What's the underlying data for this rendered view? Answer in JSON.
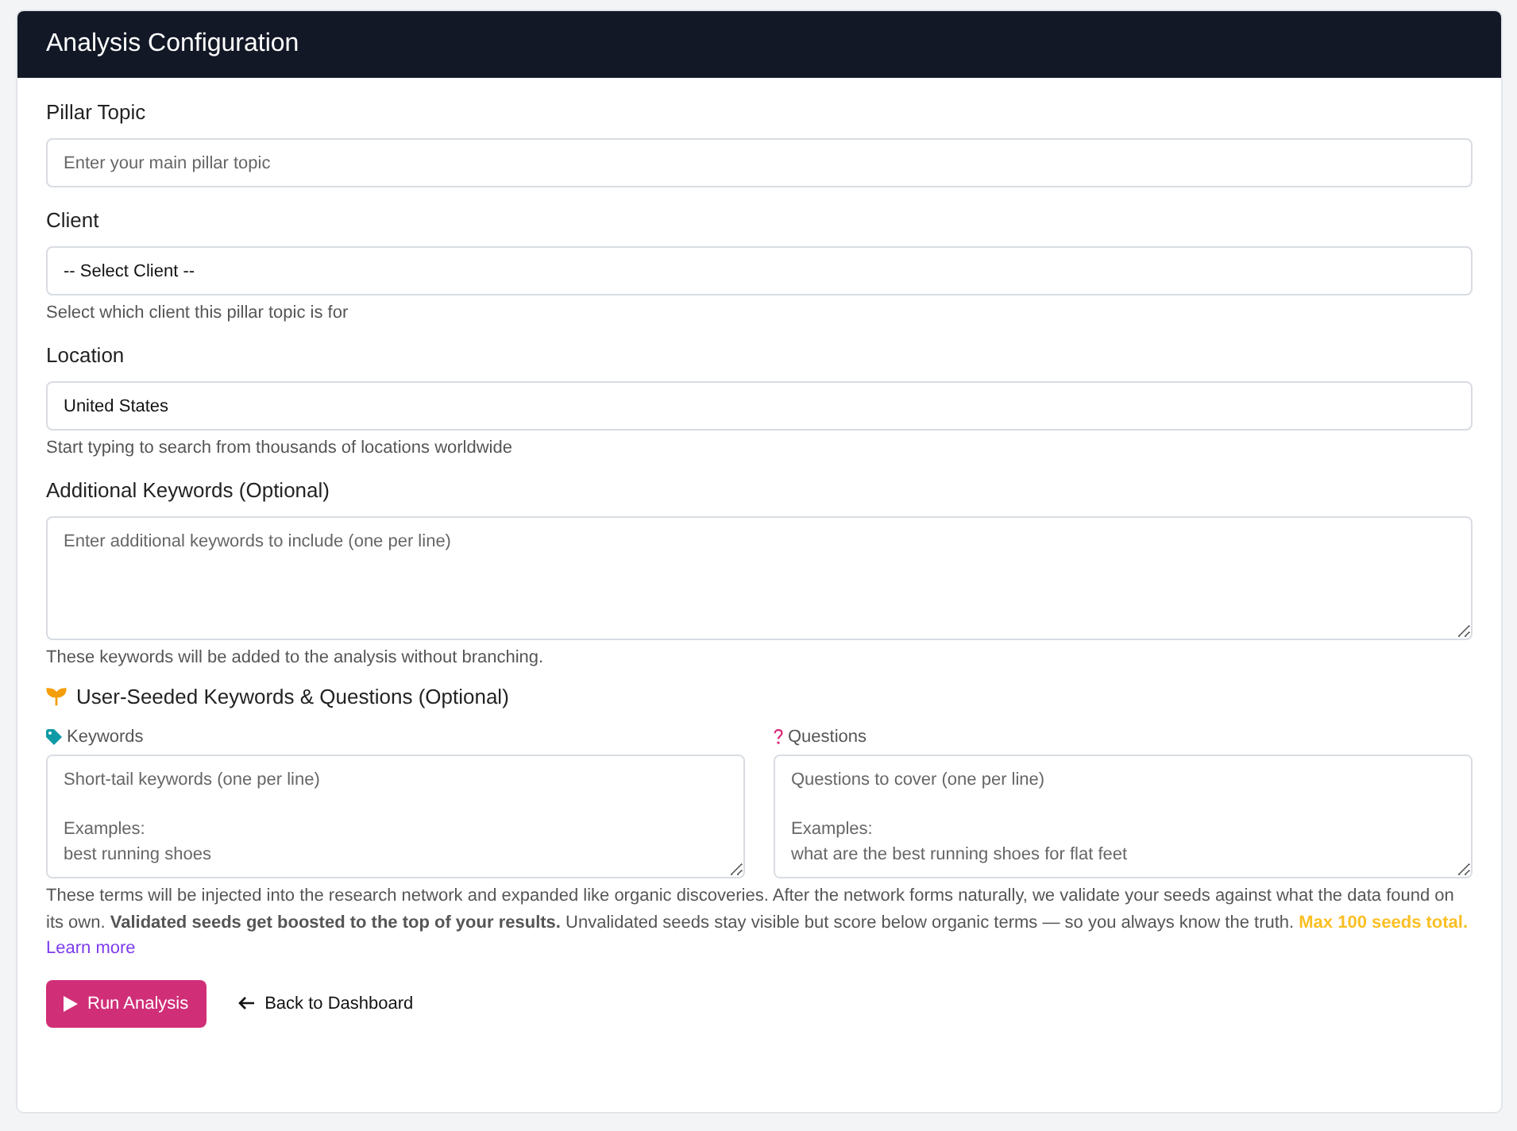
{
  "header": {
    "title": "Analysis Configuration"
  },
  "fields": [
    {
      "kind": "input",
      "label": "Pillar Topic",
      "placeholder": "Enter your main pillar topic"
    },
    {
      "kind": "select",
      "label": "Client",
      "value": "-- Select Client --",
      "help": "Select which client this pillar topic is for"
    },
    {
      "kind": "input",
      "label": "Location",
      "value": "United States",
      "help": "Start typing to search from thousands of locations worldwide"
    },
    {
      "kind": "textarea",
      "label": "Additional Keywords (Optional)",
      "placeholder": "Enter additional keywords to include (one per line)",
      "help": "These keywords will be added to the analysis without branching."
    }
  ],
  "seeds": {
    "title": "User-Seeded Keywords & Questions (Optional)",
    "columns": [
      {
        "kind": "keywords",
        "label": "Keywords",
        "placeholder": "Short-tail keywords (one per line)\n\nExamples:\nbest running shoes"
      },
      {
        "kind": "questions",
        "label": "Questions",
        "placeholder": "Questions to cover (one per line)\n\nExamples:\nwhat are the best running shoes for flat feet"
      }
    ],
    "help": "These terms will be injected into the research network and expanded like organic discoveries. After the network forms naturally, we validate your seeds against what the data found on its own. **Validated seeds get boosted to the top of your results.** Unvalidated seeds stay visible but score below organic terms — so you always know the truth.",
    "highlight": "Max 100 seeds total.",
    "link": "Learn more"
  },
  "actions": {
    "primary": "Run Analysis",
    "secondary": "Back to Dashboard"
  }
}
